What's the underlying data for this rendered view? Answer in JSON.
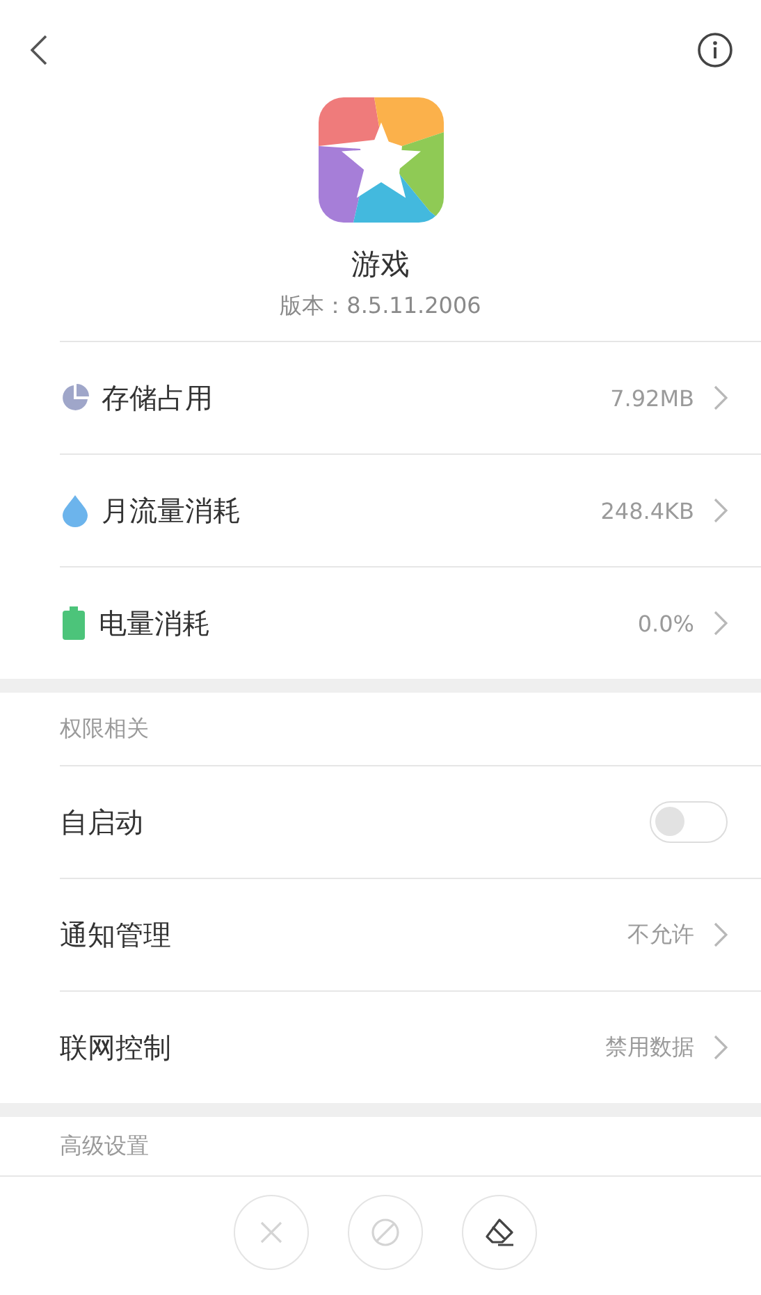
{
  "app": {
    "name": "游戏",
    "version": "版本：8.5.11.2006"
  },
  "usage": [
    {
      "label": "存储占用",
      "value": "7.92MB"
    },
    {
      "label": "月流量消耗",
      "value": "248.4KB"
    },
    {
      "label": "电量消耗",
      "value": "0.0%"
    }
  ],
  "sections": [
    {
      "title": "权限相关",
      "rows": [
        {
          "kind": "toggle",
          "label": "自启动",
          "on": false
        },
        {
          "kind": "value",
          "label": "通知管理",
          "value": "不允许"
        },
        {
          "kind": "value",
          "label": "联网控制",
          "value": "禁用数据"
        }
      ]
    },
    {
      "title": "高级设置"
    }
  ],
  "actions": [
    {
      "disabled": true
    },
    {
      "disabled": true
    },
    {
      "disabled": false
    }
  ]
}
